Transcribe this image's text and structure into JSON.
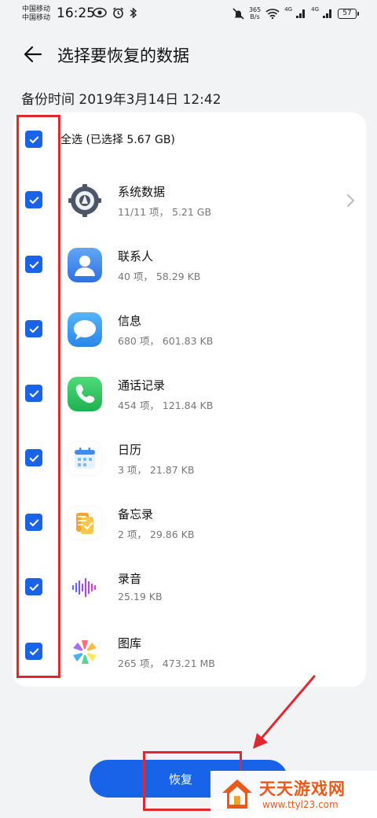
{
  "status_bar": {
    "carrier_1": "中国移动",
    "carrier_2": "中国移动",
    "time": "16:25",
    "net_speed_value": "365",
    "net_speed_unit": "B/s",
    "signal_1_label": "4G",
    "signal_2_label": "4G",
    "battery": "57"
  },
  "header": {
    "title": "选择要恢复的数据",
    "backup_time": "备份时间 2019年3月14日 12:42"
  },
  "select_all": {
    "label": "全选 (已选择 5.67 GB)",
    "checked": true
  },
  "items": [
    {
      "name": "系统数据",
      "meta": "11/11 项， 5.21 GB",
      "icon": "system-data-icon",
      "checked": true,
      "has_chevron": true
    },
    {
      "name": "联系人",
      "meta": "40 项， 58.29 KB",
      "icon": "contacts-icon",
      "checked": true
    },
    {
      "name": "信息",
      "meta": "680 项， 601.83 KB",
      "icon": "messages-icon",
      "checked": true
    },
    {
      "name": "通话记录",
      "meta": "454 项， 121.84 KB",
      "icon": "call-log-icon",
      "checked": true
    },
    {
      "name": "日历",
      "meta": "3 项， 21.87 KB",
      "icon": "calendar-icon",
      "checked": true
    },
    {
      "name": "备忘录",
      "meta": "2 项， 29.86 KB",
      "icon": "notes-icon",
      "checked": true
    },
    {
      "name": "录音",
      "meta": "25.19 KB",
      "icon": "recorder-icon",
      "checked": true
    },
    {
      "name": "图库",
      "meta": "265 项， 473.21 MB",
      "icon": "gallery-icon",
      "checked": true
    }
  ],
  "restore_button": {
    "label": "恢复"
  },
  "watermark": {
    "title": "天天游戏网",
    "url": "www.ttyl23.com"
  },
  "colors": {
    "accent": "#1863e8",
    "annotation": "#e0282e",
    "watermark": "#e8591c",
    "background": "#f1f3f5"
  }
}
